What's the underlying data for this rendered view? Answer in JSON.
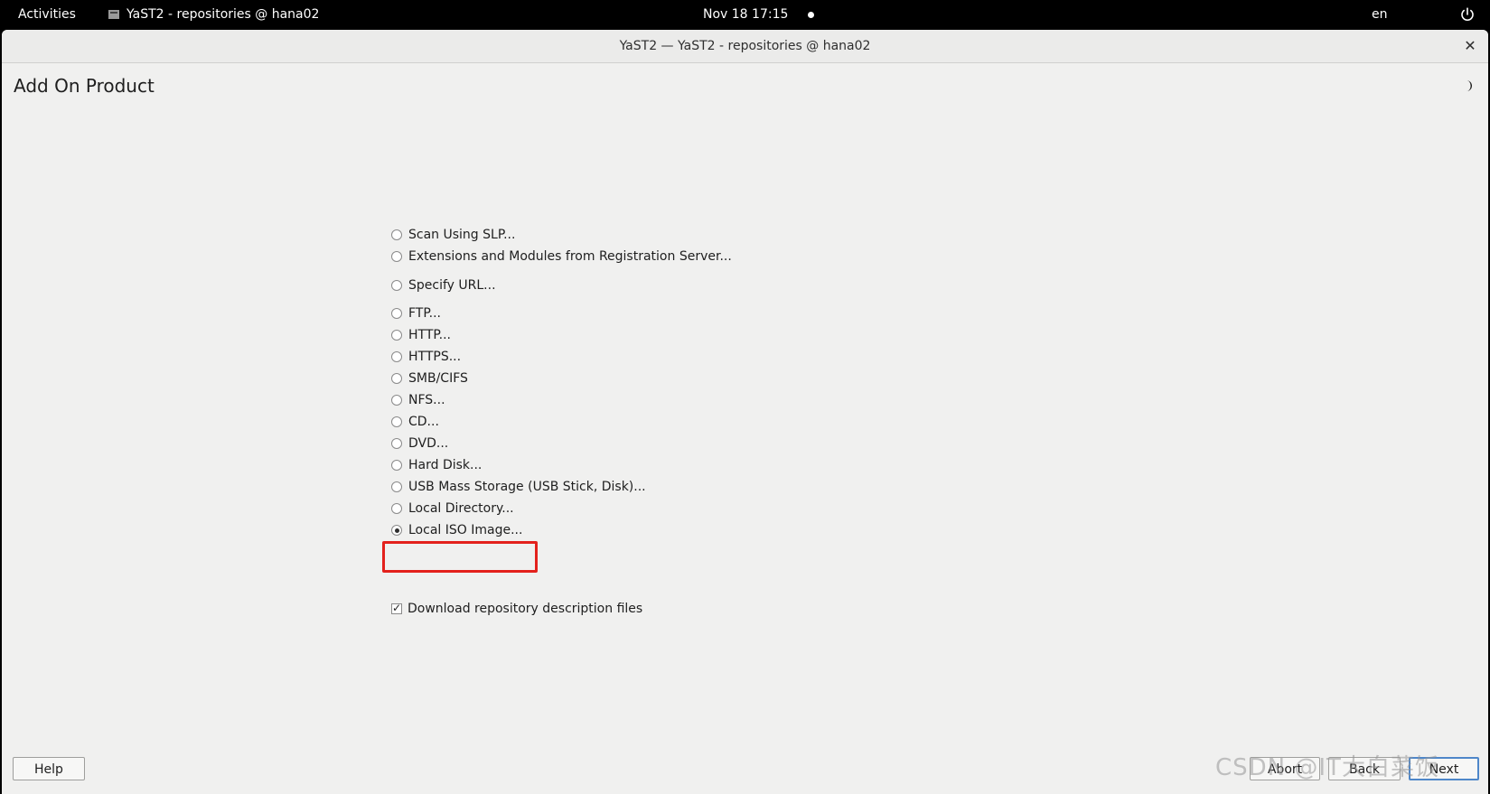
{
  "topbar": {
    "activities": "Activities",
    "app_name": "YaST2 - repositories @ hana02",
    "clock": "Nov 18  17:15",
    "language": "en",
    "power_icon": "power-icon"
  },
  "window": {
    "title": "YaST2 — YaST2 - repositories @ hana02",
    "close_glyph": "✕",
    "page_title": "Add On Product",
    "theme_icon": "moon-icon"
  },
  "options": [
    {
      "label": "Scan Using SLP...",
      "checked": false
    },
    {
      "label": "Extensions and Modules from Registration Server...",
      "checked": false
    },
    {
      "label": "Specify URL...",
      "checked": false
    },
    {
      "label": "FTP...",
      "checked": false
    },
    {
      "label": "HTTP...",
      "checked": false
    },
    {
      "label": "HTTPS...",
      "checked": false
    },
    {
      "label": "SMB/CIFS",
      "checked": false
    },
    {
      "label": "NFS...",
      "checked": false
    },
    {
      "label": "CD...",
      "checked": false
    },
    {
      "label": "DVD...",
      "checked": false
    },
    {
      "label": "Hard Disk...",
      "checked": false
    },
    {
      "label": "USB Mass Storage (USB Stick, Disk)...",
      "checked": false
    },
    {
      "label": "Local Directory...",
      "checked": false
    },
    {
      "label": "Local ISO Image...",
      "checked": true
    }
  ],
  "download": {
    "label": "Download repository description files",
    "checked": true,
    "check_glyph": "✓"
  },
  "buttons": {
    "help": "Help",
    "abort": "Abort",
    "back": "Back",
    "next": "Next"
  },
  "watermark": "CSDN @IT大白菜饭"
}
